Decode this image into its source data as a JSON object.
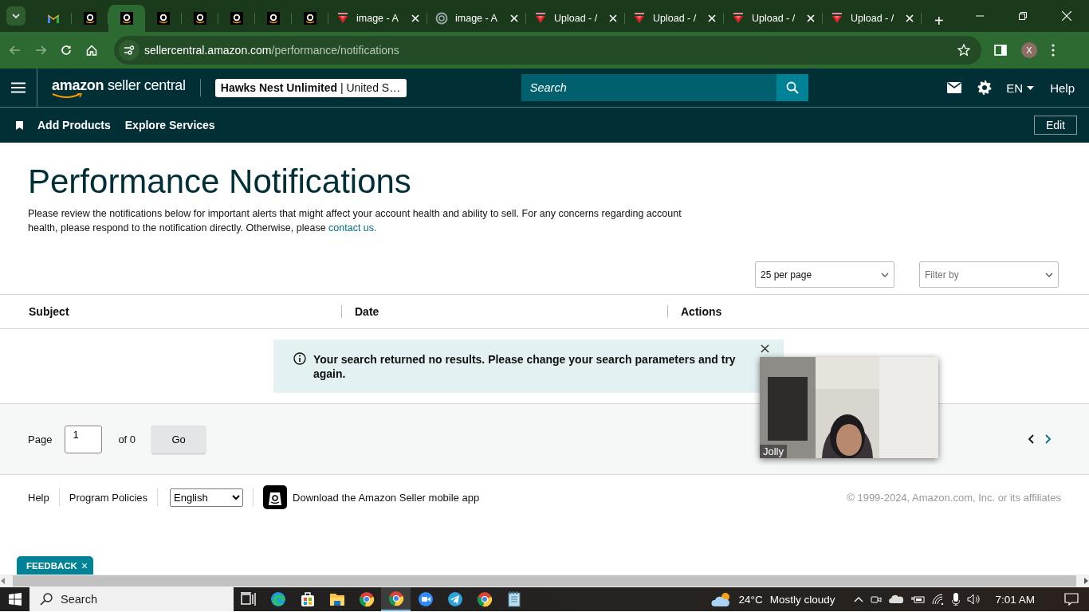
{
  "browser": {
    "tabs": [
      {
        "kind": "mail",
        "selected": false
      },
      {
        "kind": "amazon",
        "selected": false
      },
      {
        "kind": "amazon",
        "selected": true
      },
      {
        "kind": "amazon",
        "selected": false
      },
      {
        "kind": "amazon",
        "selected": false
      },
      {
        "kind": "amazon",
        "selected": false
      },
      {
        "kind": "amazon",
        "selected": false
      },
      {
        "kind": "amazon",
        "selected": false
      },
      {
        "kind": "gem",
        "title": "image - A",
        "selected": false
      },
      {
        "kind": "ring",
        "title": "image - A",
        "selected": false
      },
      {
        "kind": "gem",
        "title": "Upload - /",
        "selected": false
      },
      {
        "kind": "gem",
        "title": "Upload - /",
        "selected": false
      },
      {
        "kind": "gem",
        "title": "Upload - /",
        "selected": false
      },
      {
        "kind": "gem",
        "title": "Upload - /",
        "selected": false
      }
    ],
    "new_tab": "+",
    "address": {
      "domain": "sellercentral.amazon.com",
      "path": "/performance/notifications"
    },
    "profile": "X"
  },
  "header": {
    "logo": {
      "brand": "amazon",
      "product": "seller central"
    },
    "account": {
      "store": "Hawks Nest Unlimited",
      "region": "| United S…"
    },
    "search": {
      "placeholder": "Search"
    },
    "language": "EN",
    "help": "Help",
    "nav_links": [
      "Add Products",
      "Explore Services"
    ],
    "edit": "Edit"
  },
  "page": {
    "title": "Performance Notifications",
    "intro": "Please review the notifications below for important alerts that might affect your account health and ability to sell. For any concerns regarding account health, please respond to the notification directly. Otherwise, please ",
    "contact_link": "contact us.",
    "per_page": "25 per page",
    "filter": {
      "placeholder": "Filter by"
    },
    "columns": [
      "Subject",
      "Date",
      "Actions"
    ],
    "message": "Your search returned no results. Please change your search parameters and try again.",
    "pagination": {
      "label": "Page",
      "value": "1",
      "of": "of 0",
      "go": "Go"
    },
    "video": {
      "kind": "picture",
      "name": "Jolly"
    }
  },
  "footer": {
    "links": [
      "Help",
      "Program Policies"
    ],
    "language": "English",
    "app": "Download the Amazon Seller mobile app",
    "copyright": "© 1999-2024, Amazon.com, Inc. or its affiliates",
    "feedback": "FEEDBACK",
    "feedback_close": "×"
  },
  "taskbar": {
    "search": {
      "placeholder": "Search"
    },
    "apps": [
      {
        "kind": "taskview",
        "active": false
      },
      {
        "kind": "edge",
        "active": false
      },
      {
        "kind": "store",
        "active": false
      },
      {
        "kind": "folder",
        "active": false
      },
      {
        "kind": "chrome",
        "active": false
      },
      {
        "kind": "chrome",
        "active": true
      },
      {
        "kind": "zoom",
        "active": false
      },
      {
        "kind": "telegram",
        "active": false
      },
      {
        "kind": "chrome",
        "active": false
      },
      {
        "kind": "notepad",
        "active": false
      }
    ],
    "weather": {
      "temperature": "24°C",
      "condition": "Mostly cloudy"
    },
    "time": "7:01 AM"
  }
}
